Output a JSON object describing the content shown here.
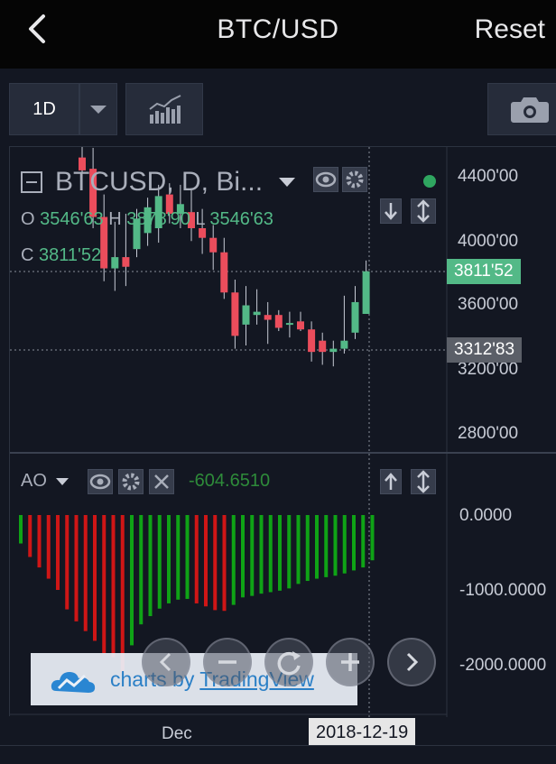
{
  "header": {
    "title": "BTC/USD",
    "reset_label": "Reset"
  },
  "toolbar": {
    "interval_label": "1D"
  },
  "legend": {
    "symbol": "BTCUSD, D, Bi...",
    "o_label": "O",
    "o_value": "3546'63",
    "h_label": "H",
    "h_value": "3878'90",
    "l_label": "L",
    "l_value": "3546'63",
    "c_label": "C",
    "c_value": "3811'52"
  },
  "price_axis": {
    "ticks": [
      "4400'00",
      "4000'00",
      "3600'00",
      "3200'00",
      "2800'00"
    ]
  },
  "price_tags": {
    "last": "3811'52",
    "crosshair": "3312'83"
  },
  "indicator": {
    "name": "AO",
    "value": "-604.6510"
  },
  "ao_axis": {
    "ticks": [
      "0.0000",
      "-1000.0000",
      "-2000.0000"
    ]
  },
  "time_axis": {
    "month_label": "Dec",
    "crosshair_date": "2018-12-19"
  },
  "watermark": {
    "prefix": "charts by ",
    "brand": "TradingView"
  },
  "colors": {
    "up": "#53b987",
    "down": "#eb4d5c",
    "bg": "#131722",
    "ao_up": "#0fa316",
    "ao_down": "#cf1616"
  },
  "chart_data": [
    {
      "type": "candlestick",
      "title": "BTCUSD, D",
      "ylim": [
        2700,
        4600
      ],
      "candles": [
        {
          "o": 4520,
          "h": 4620,
          "l": 4360,
          "c": 4440
        },
        {
          "o": 4450,
          "h": 4580,
          "l": 4080,
          "c": 4150
        },
        {
          "o": 4150,
          "h": 4290,
          "l": 3750,
          "c": 3830
        },
        {
          "o": 3830,
          "h": 4120,
          "l": 3690,
          "c": 3900
        },
        {
          "o": 3900,
          "h": 4170,
          "l": 3720,
          "c": 3840
        },
        {
          "o": 3950,
          "h": 4200,
          "l": 3900,
          "c": 4140
        },
        {
          "o": 4050,
          "h": 4270,
          "l": 3970,
          "c": 4210
        },
        {
          "o": 4080,
          "h": 4350,
          "l": 3990,
          "c": 4280
        },
        {
          "o": 4290,
          "h": 4360,
          "l": 4110,
          "c": 4170
        },
        {
          "o": 4170,
          "h": 4350,
          "l": 4080,
          "c": 4230
        },
        {
          "o": 4180,
          "h": 4330,
          "l": 4000,
          "c": 4080
        },
        {
          "o": 4080,
          "h": 4200,
          "l": 3920,
          "c": 4020
        },
        {
          "o": 4020,
          "h": 4100,
          "l": 3820,
          "c": 3930
        },
        {
          "o": 3930,
          "h": 4020,
          "l": 3640,
          "c": 3680
        },
        {
          "o": 3680,
          "h": 3760,
          "l": 3330,
          "c": 3410
        },
        {
          "o": 3480,
          "h": 3720,
          "l": 3350,
          "c": 3600
        },
        {
          "o": 3540,
          "h": 3700,
          "l": 3480,
          "c": 3560
        },
        {
          "o": 3540,
          "h": 3620,
          "l": 3360,
          "c": 3510
        },
        {
          "o": 3540,
          "h": 3570,
          "l": 3440,
          "c": 3460
        },
        {
          "o": 3480,
          "h": 3560,
          "l": 3400,
          "c": 3490
        },
        {
          "o": 3500,
          "h": 3560,
          "l": 3440,
          "c": 3450
        },
        {
          "o": 3450,
          "h": 3500,
          "l": 3250,
          "c": 3310
        },
        {
          "o": 3380,
          "h": 3430,
          "l": 3230,
          "c": 3310
        },
        {
          "o": 3310,
          "h": 3380,
          "l": 3220,
          "c": 3330
        },
        {
          "o": 3330,
          "h": 3660,
          "l": 3300,
          "c": 3380
        },
        {
          "o": 3430,
          "h": 3720,
          "l": 3390,
          "c": 3620
        },
        {
          "o": 3546.63,
          "h": 3878.9,
          "l": 3546.63,
          "c": 3811.52
        }
      ]
    },
    {
      "type": "bar",
      "title": "AO",
      "ylim": [
        -2200,
        150
      ],
      "values": [
        -380,
        -560,
        -700,
        -850,
        -1000,
        -1260,
        -1420,
        -1550,
        -1680,
        -1850,
        -1900,
        -2100,
        -1740,
        -1460,
        -1350,
        -1250,
        -1180,
        -1130,
        -1120,
        -1180,
        -1220,
        -1270,
        -1280,
        -1200,
        -1100,
        -1080,
        -1050,
        -1030,
        -1010,
        -980,
        -920,
        -880,
        -850,
        -830,
        -810,
        -780,
        -740,
        -700,
        -604.651
      ]
    }
  ]
}
